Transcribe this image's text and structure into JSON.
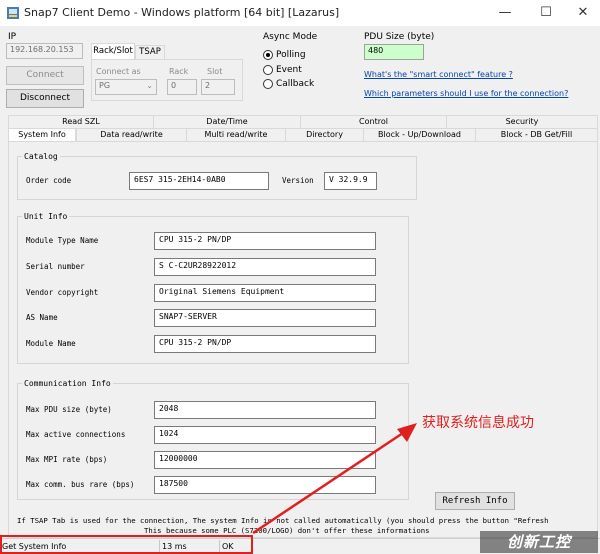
{
  "window": {
    "title": "Snap7 Client Demo - Windows platform [64 bit] [Lazarus]",
    "minimize": "—",
    "maximize": "☐",
    "close": "✕"
  },
  "connection": {
    "ip_label": "IP",
    "ip_value": "192.168.20.153",
    "connect_label": "Connect",
    "disconnect_label": "Disconnect",
    "tabs": [
      "Rack/Slot",
      "TSAP"
    ],
    "connect_as_label": "Connect as",
    "connect_as_value": "PG",
    "rack_label": "Rack",
    "rack_value": "0",
    "slot_label": "Slot",
    "slot_value": "2"
  },
  "async_mode": {
    "label": "Async Mode",
    "options": [
      "Polling",
      "Event",
      "Callback"
    ],
    "selected": "Polling"
  },
  "pdu": {
    "label": "PDU Size (byte)",
    "value": "480",
    "link1": "What's the \"smart connect\" feature ?",
    "link2": "Which parameters should I use for the connection?"
  },
  "tabs_row1": [
    "Read SZL",
    "Date/Time",
    "Control",
    "Security"
  ],
  "tabs_row2": [
    "System Info",
    "Data read/write",
    "Multi read/write",
    "Directory",
    "Block - Up/Download",
    "Block - DB Get/Fill"
  ],
  "catalog": {
    "title": "Catalog",
    "order_code_label": "Order code",
    "order_code_value": "6ES7 315-2EH14-0AB0",
    "version_label": "Version",
    "version_value": "V 32.9.9"
  },
  "unit_info": {
    "title": "Unit Info",
    "rows": [
      {
        "label": "Module Type Name",
        "value": "CPU 315-2 PN/DP"
      },
      {
        "label": "Serial number",
        "value": "S C-C2UR28922012"
      },
      {
        "label": "Vendor copyright",
        "value": "Original Siemens Equipment"
      },
      {
        "label": "AS Name",
        "value": "SNAP7-SERVER"
      },
      {
        "label": "Module Name",
        "value": "CPU 315-2 PN/DP"
      }
    ]
  },
  "comm_info": {
    "title": "Communication Info",
    "rows": [
      {
        "label": "Max PDU size (byte)",
        "value": "2048"
      },
      {
        "label": "Max active connections",
        "value": "1024"
      },
      {
        "label": "Max MPI rate (bps)",
        "value": "12000000"
      },
      {
        "label": "Max comm. bus rare (bps)",
        "value": "187500"
      }
    ]
  },
  "refresh_label": "Refresh Info",
  "note_line1": "If TSAP Tab is used for the connection, The system Info is not called automatically (you should press the button \"Refresh",
  "note_line2": "This because some PLC (S7200/LOGO) don't offer these informations",
  "annotation": {
    "text": "获取系统信息成功",
    "color": "#e02020"
  },
  "statusbar": {
    "operation": "Get System Info",
    "time": "13 ms",
    "result": "OK"
  },
  "watermark": "创新工控"
}
